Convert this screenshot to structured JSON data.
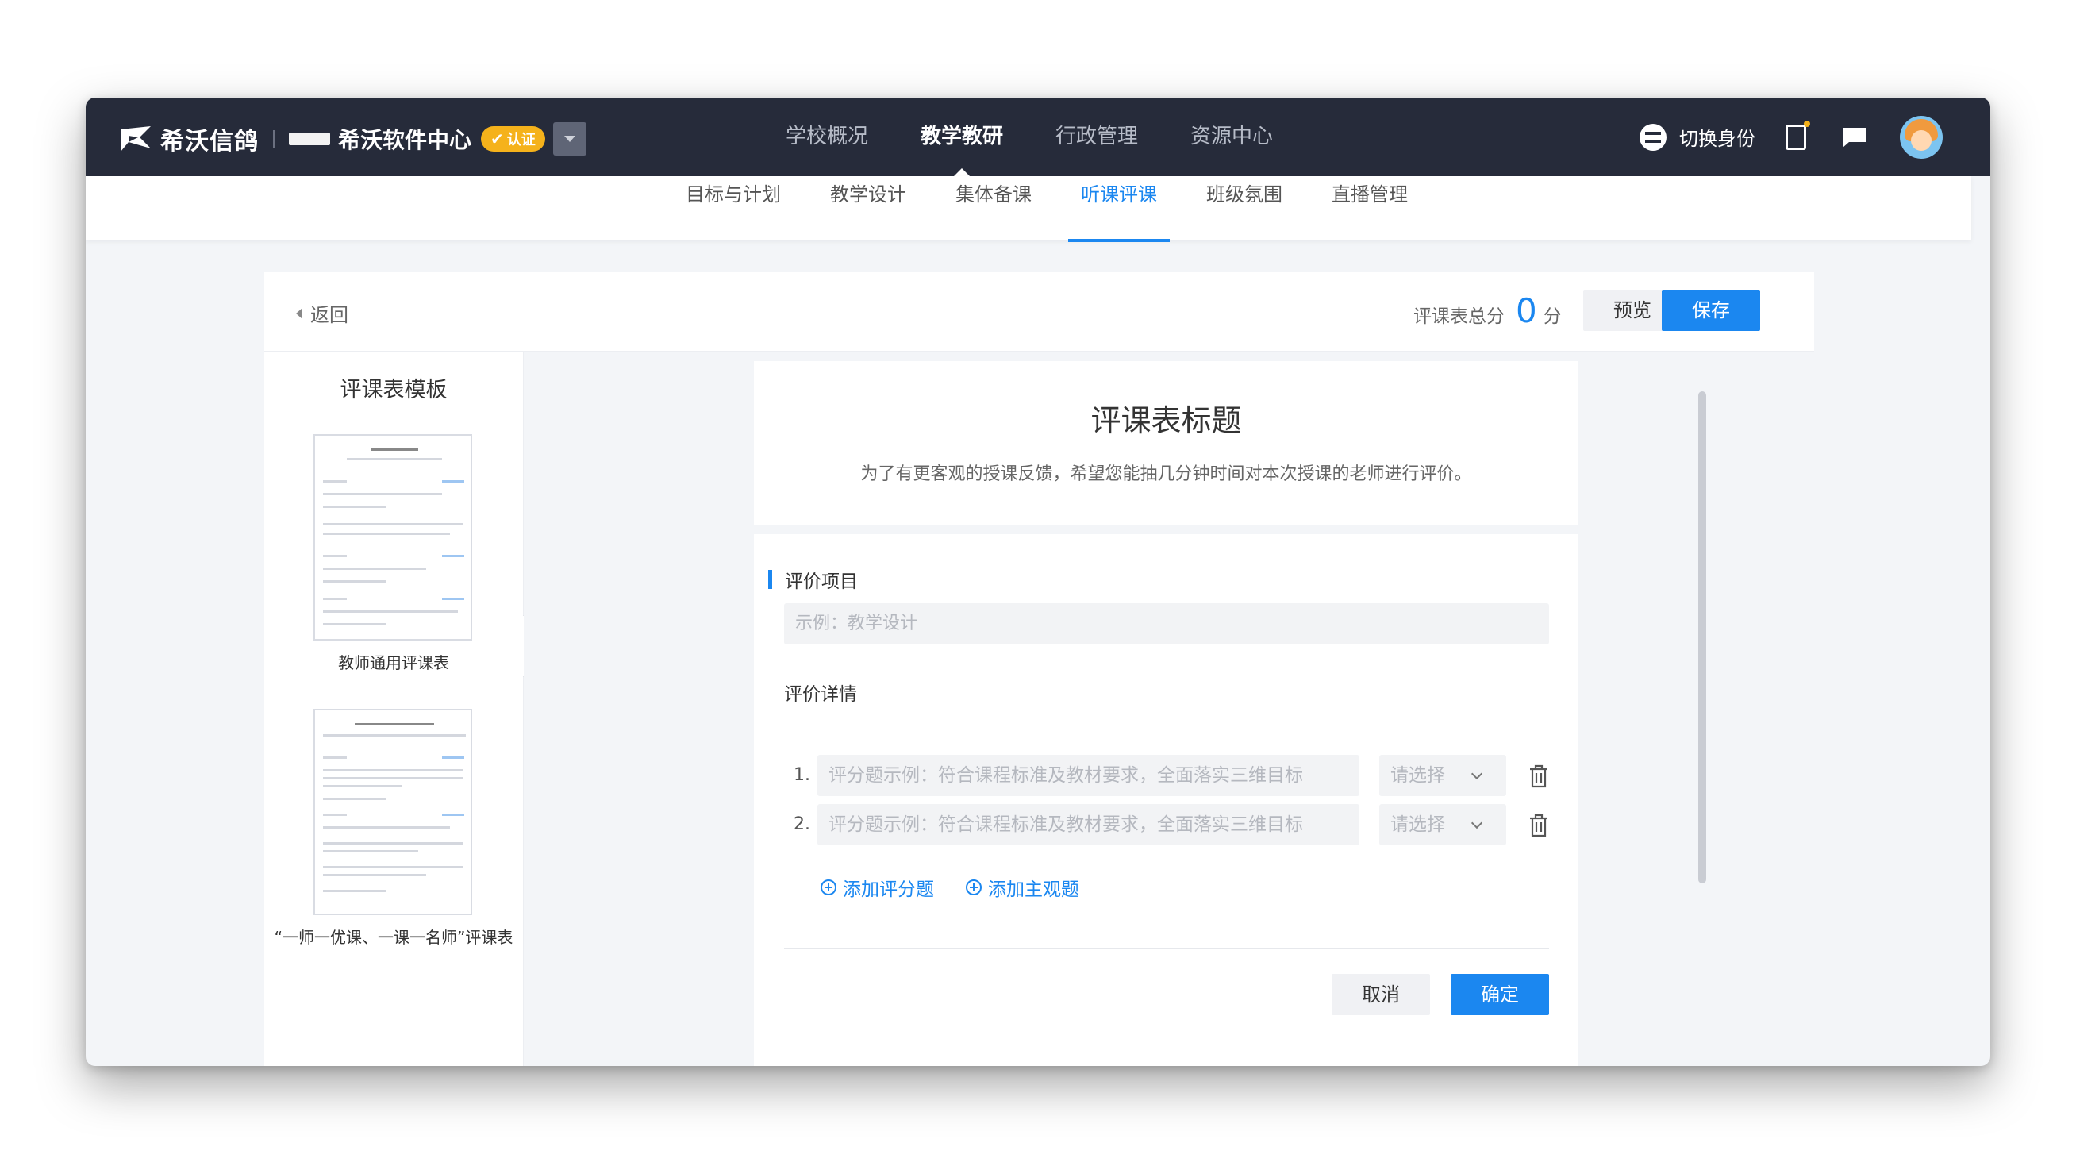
{
  "header": {
    "brand": "希沃信鸽",
    "school_name": "希沃软件中心",
    "cert_label": "认证",
    "nav": [
      "学校概况",
      "教学教研",
      "行政管理",
      "资源中心"
    ],
    "nav_active": 1,
    "switch_identity": "切换身份",
    "icons": [
      "book-icon",
      "message-icon",
      "avatar"
    ]
  },
  "subnav": {
    "items": [
      "目标与计划",
      "教学设计",
      "集体备课",
      "听课评课",
      "班级氛围",
      "直播管理"
    ],
    "active": 3
  },
  "editor": {
    "back_label": "返回",
    "score_label": "评课表总分",
    "score_value": "0",
    "score_unit": "分",
    "preview_label": "预览",
    "save_label": "保存"
  },
  "templates": {
    "title": "评课表模板",
    "items": [
      {
        "label": "教师通用评课表"
      },
      {
        "label": "“一师一优课、一课一名师”评课表"
      }
    ]
  },
  "form": {
    "title": "评课表标题",
    "description": "为了有更客观的授课反馈，希望您能抽几分钟时间对本次授课的老师进行评价。",
    "section_label": "评价项目",
    "item_placeholder": "示例：教学设计",
    "detail_label": "评价详情",
    "questions": [
      {
        "index": "1.",
        "placeholder": "评分题示例：符合课程标准及教材要求，全面落实三维目标",
        "select": "请选择"
      },
      {
        "index": "2.",
        "placeholder": "评分题示例：符合课程标准及教材要求，全面落实三维目标",
        "select": "请选择"
      }
    ],
    "add_score_label": "添加评分题",
    "add_subjective_label": "添加主观题",
    "cancel_label": "取消",
    "confirm_label": "确定"
  },
  "colors": {
    "accent": "#1b87f0",
    "topbar": "#262b3a",
    "badge": "#f5b21b"
  }
}
